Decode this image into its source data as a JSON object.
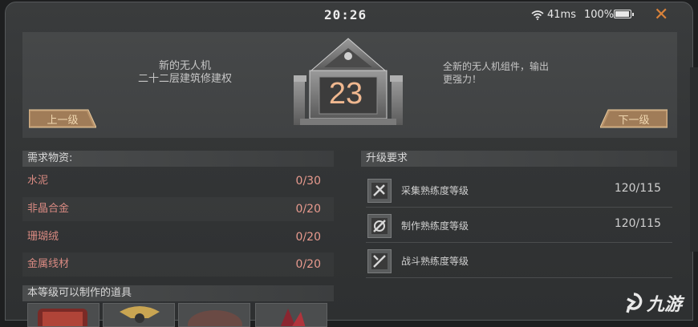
{
  "status": {
    "time": "20:26",
    "ping": "41ms",
    "battery": "100%"
  },
  "hero": {
    "left_lines": [
      "新的无人机",
      "二十二层建筑修建权"
    ],
    "right_lines": [
      "全新的无人机组件，输出",
      "更强力！"
    ],
    "level": "23",
    "prev_label": "上一级",
    "next_label": "下一级"
  },
  "materials": {
    "title": "需求物资:",
    "rows": [
      {
        "name": "水泥",
        "value": "0/30"
      },
      {
        "name": "非晶合金",
        "value": "0/20"
      },
      {
        "name": "珊瑚绒",
        "value": "0/20"
      },
      {
        "name": "金属线材",
        "value": "0/20"
      }
    ]
  },
  "requirements": {
    "title": "升级要求",
    "rows": [
      {
        "name": "采集熟练度等级",
        "value": "120/115",
        "icon": "gather-icon"
      },
      {
        "name": "制作熟练度等级",
        "value": "120/115",
        "icon": "craft-icon"
      },
      {
        "name": "战斗熟练度等级",
        "value": "",
        "icon": "combat-icon"
      }
    ]
  },
  "craftable": {
    "title": "本等级可以制作的道具"
  },
  "watermark": "九游",
  "colors": {
    "accent": "#d9823a",
    "material_text": "#d98a82",
    "level_number": "#f0b890"
  }
}
